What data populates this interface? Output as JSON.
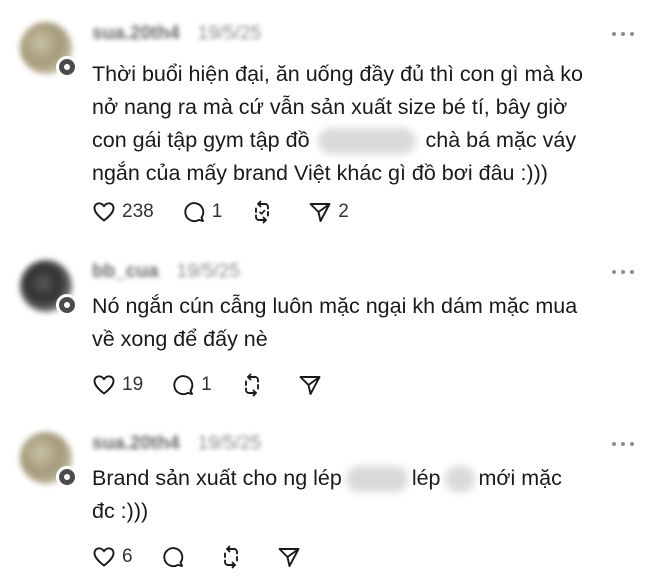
{
  "comments": [
    {
      "username": "sua.20th4",
      "date": "19/5/25",
      "lines": [
        "Thời buổi hiện đại, ăn uống đầy đủ thì con gì mà ko",
        "nở nang ra mà cứ vẫn sản xuất size bé tí, bây giờ",
        "con gái tập gym tập đồ",
        "chà bá mặc váy",
        "ngắn của mấy brand Việt khác gì đồ bơi đâu :)))"
      ],
      "likes": "238",
      "replies": "1",
      "reposts": "",
      "shares": "2"
    },
    {
      "username": "bb_cua",
      "date": "19/5/25",
      "lines": [
        "Nó ngắn cún cẫng luôn mặc ngại kh dám mặc mua",
        "về xong để đấy nè"
      ],
      "likes": "19",
      "replies": "1",
      "reposts": "",
      "shares": ""
    },
    {
      "username": "sua.20th4",
      "date": "19/5/25",
      "lines": [
        "Brand sản xuất cho ng lép",
        "lép",
        "mới mặc",
        "đc :)))"
      ],
      "likes": "6",
      "replies": "",
      "reposts": "",
      "shares": ""
    }
  ],
  "icons": {
    "like": "heart-icon",
    "reply": "comment-bubble-icon",
    "repost": "repost-icon",
    "share": "send-icon",
    "more": "more-dots-icon"
  },
  "colors": {
    "text": "#1a1a1a",
    "muted": "#8a8a8a",
    "icon": "#1a1a1a",
    "badge": "#4b4b4b"
  }
}
